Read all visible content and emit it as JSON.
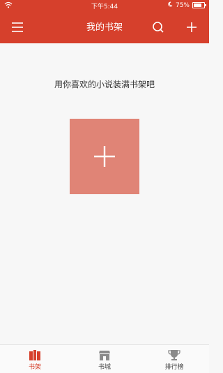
{
  "status_bar": {
    "time": "下午5:44",
    "battery": "75%",
    "battery_fraction": 0.75
  },
  "header": {
    "title": "我的书架"
  },
  "empty_state": {
    "message": "用你喜欢的小说装满书架吧"
  },
  "tabs": [
    {
      "label": "书架",
      "icon": "bookshelf-icon",
      "active": true
    },
    {
      "label": "书城",
      "icon": "store-icon",
      "active": false
    },
    {
      "label": "排行榜",
      "icon": "trophy-icon",
      "active": false
    }
  ],
  "colors": {
    "brand": "#d6402c",
    "tile": "#e08476",
    "background": "#f7f7f7"
  }
}
